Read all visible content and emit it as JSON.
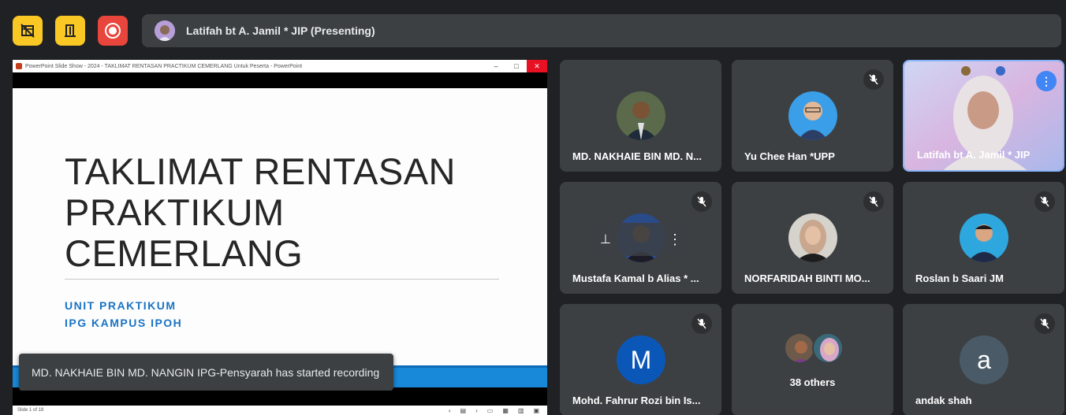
{
  "toolbar": {
    "layout_icon": "grid-off-icon",
    "exit_icon": "door-exit-icon",
    "record_icon": "record-icon"
  },
  "presenter": {
    "name": "Latifah bt A. Jamil * JIP (Presenting)"
  },
  "powerpoint": {
    "title": "PowerPoint Slide Show  -  2024 - TAKLIMAT RENTASAN PRACTIKUM CEMERLANG Untuk Peserta - PowerPoint",
    "status": "Slide 1 of 18"
  },
  "slide": {
    "title_line1": "TAKLIMAT RENTASAN",
    "title_line2": "PRAKTIKUM",
    "title_line3": "CEMERLANG",
    "sub1": "UNIT PRAKTIKUM",
    "sub2": "IPG KAMPUS IPOH"
  },
  "toast": {
    "text": "MD. NAKHAIE BIN MD. NANGIN IPG-Pensyarah has started recording"
  },
  "participants": [
    {
      "name": "MD. NAKHAIE BIN MD. N...",
      "muted": false
    },
    {
      "name": "Yu Chee Han *UPP",
      "muted": true
    },
    {
      "name": "Latifah bt A. Jamil * JIP",
      "muted": false
    },
    {
      "name": "Mustafa Kamal b Alias * ...",
      "muted": true
    },
    {
      "name": "NORFARIDAH BINTI MO...",
      "muted": true
    },
    {
      "name": "Roslan b Saari JM",
      "muted": true
    },
    {
      "name": "Mohd. Fahrur Rozi bin Is...",
      "muted": true,
      "initial": "M"
    },
    {
      "name": "38 others",
      "muted": false
    },
    {
      "name": "andak shah",
      "muted": true,
      "initial": "a"
    }
  ],
  "colors": {
    "background": "#202124",
    "tile": "#3c4043",
    "accent_blue": "#1a73c4",
    "record_red": "#e8453c",
    "toolbar_yellow": "#f9c824"
  }
}
